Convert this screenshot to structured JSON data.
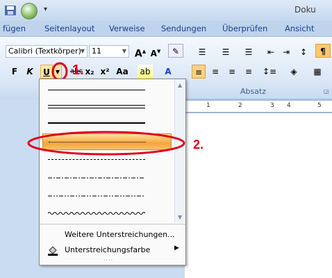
{
  "title_bar": {
    "doc_title": "Doku",
    "quick_access_dropdown": "▾"
  },
  "tabs": [
    "fügen",
    "Seitenlayout",
    "Verweise",
    "Sendungen",
    "Überprüfen",
    "Ansicht"
  ],
  "font": {
    "name": "Calibri (Textkörper)",
    "size": "11"
  },
  "format_buttons": {
    "bold": "F",
    "italic": "K",
    "underline": "U",
    "strike": "abc",
    "subscript": "x₂",
    "superscript": "x²",
    "case": "Aa",
    "font_color": "A"
  },
  "grow_font": "A",
  "shrink_font": "A",
  "group_labels": {
    "absatz": "Absatz"
  },
  "ruler_marks": [
    "1",
    "2",
    "3",
    "4",
    "5"
  ],
  "annotations": {
    "step1": "1.",
    "step2": "2."
  },
  "menu": {
    "underline_styles": [
      "single",
      "double",
      "thick",
      "dotted",
      "dashed",
      "dash-dot",
      "dash-dot-dot",
      "wave"
    ],
    "selected_index": 3,
    "more_underlines": "Weitere Unterstreichungen...",
    "underline_color": "Unterstreichungsfarbe"
  },
  "colors": {
    "highlight_orange": "#f7a43a",
    "annotation_red": "#e0001b",
    "ribbon_blue": "#15428b"
  }
}
